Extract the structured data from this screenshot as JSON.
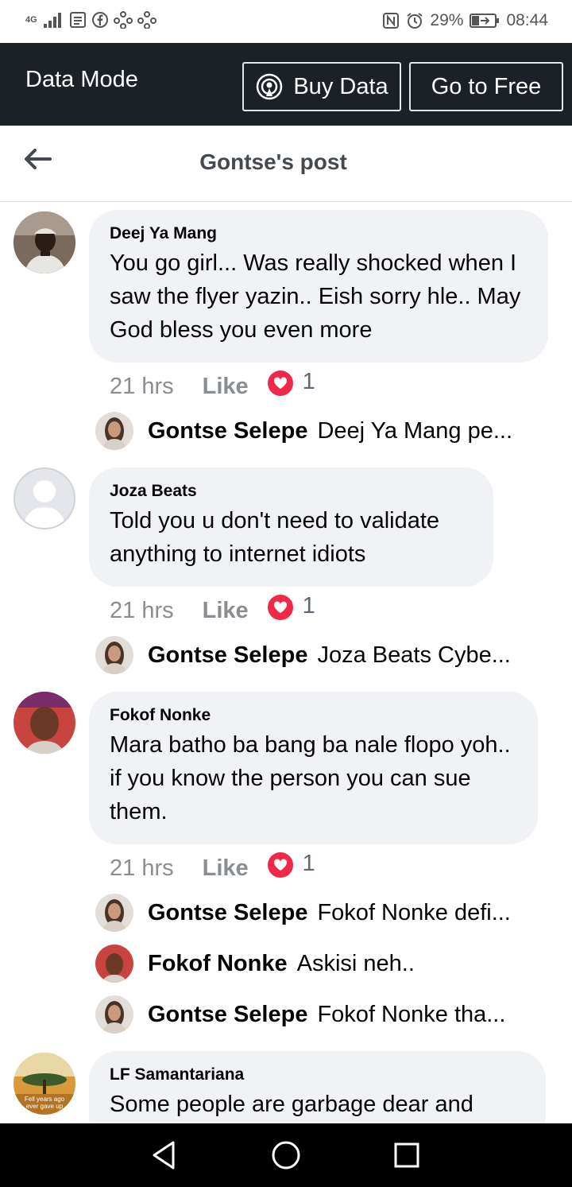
{
  "status_bar": {
    "network": "4G",
    "battery": "29%",
    "time": "08:44"
  },
  "data_bar": {
    "mode_label": "Data Mode",
    "buy_data_label": "Buy Data",
    "go_free_label": "Go to Free"
  },
  "header": {
    "title": "Gontse's post"
  },
  "comments": [
    {
      "author": "Deej Ya Mang",
      "text": "You go girl... Was really shocked when I saw the flyer yazin.. Eish sorry hle.. May God bless you even more",
      "time": "21 hrs",
      "like_label": "Like",
      "reactions": "1",
      "replies": [
        {
          "author": "Gontse Selepe",
          "text": "Deej Ya Mang pe..."
        }
      ]
    },
    {
      "author": "Joza Beats",
      "text": "Told you u don't need to validate anything to internet idiots",
      "time": "21 hrs",
      "like_label": "Like",
      "reactions": "1",
      "replies": [
        {
          "author": "Gontse Selepe",
          "text": "Joza Beats Cybe..."
        }
      ]
    },
    {
      "author": "Fokof Nonke",
      "text": "Mara batho ba bang ba nale flopo yoh.. if you know the person you can sue them.",
      "time": "21 hrs",
      "like_label": "Like",
      "reactions": "1",
      "replies": [
        {
          "author": "Gontse Selepe",
          "text": "Fokof Nonke defi..."
        },
        {
          "author": "Fokof Nonke",
          "text": "Askisi neh.."
        },
        {
          "author": "Gontse Selepe",
          "text": "Fokof Nonke tha..."
        }
      ]
    },
    {
      "author": "LF Samantariana",
      "text": "Some people are garbage dear and",
      "avatar_caption": "Fell years ago ever gave up"
    }
  ],
  "colors": {
    "data_bar_bg": "#1c2127",
    "bubble_bg": "#f0f2f5",
    "heart": "#f0284a",
    "muted": "#8a8d91"
  }
}
